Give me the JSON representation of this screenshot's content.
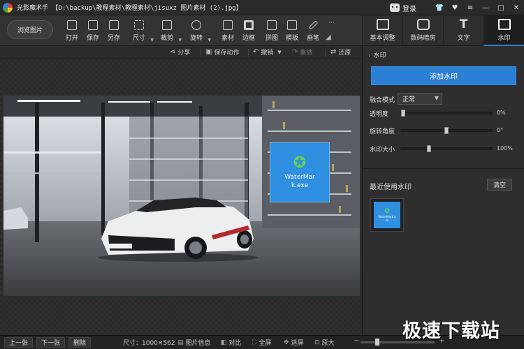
{
  "window": {
    "title": "光影魔术手 【D:\\backup\\教程素材\\教程素材\\jisuxz 图片素材 (2).jpg】",
    "login_label": "登录",
    "controls": [
      "shirt-icon",
      "heart-icon",
      "menu-icon",
      "minimize-icon",
      "maximize-icon",
      "close-icon"
    ]
  },
  "toolbar": {
    "browse_label": "浏览图片",
    "tools": [
      {
        "label": "打开",
        "icon": "open-icon"
      },
      {
        "label": "保存",
        "icon": "save-icon"
      },
      {
        "label": "另存",
        "icon": "save-as-icon"
      },
      {
        "label": "尺寸",
        "icon": "resize-icon"
      },
      {
        "label": "裁剪",
        "icon": "crop-icon"
      },
      {
        "label": "旋转",
        "icon": "rotate-icon"
      },
      {
        "label": "素材",
        "icon": "material-icon"
      },
      {
        "label": "边框",
        "icon": "border-icon"
      },
      {
        "label": "拼图",
        "icon": "collage-icon"
      },
      {
        "label": "模板",
        "icon": "template-icon"
      },
      {
        "label": "画笔",
        "icon": "brush-icon"
      }
    ],
    "more_label": "···"
  },
  "right_tabs": [
    {
      "label": "基本调整",
      "icon": "adjust-icon"
    },
    {
      "label": "数码暗房",
      "icon": "camera-icon"
    },
    {
      "label": "文字",
      "icon": "text-icon"
    },
    {
      "label": "水印",
      "icon": "watermark-icon",
      "active": true
    }
  ],
  "actionbar": {
    "share": "分享",
    "save_action": "保存动作",
    "undo": "撤销",
    "redo": "重做",
    "restore": "还原"
  },
  "canvas": {
    "watermark_text": "WaterMark.exe"
  },
  "panel": {
    "heading": "水印",
    "add_button": "添加水印",
    "blend_label": "融合模式",
    "blend_value": "正常",
    "opacity_label": "透明度",
    "opacity_value": "0%",
    "opacity_level": 0,
    "rotation_label": "旋转角度",
    "rotation_value": "0°",
    "rotation_level": 0.5,
    "size_label": "水印大小",
    "size_value": "100%",
    "size_level": 0.3,
    "recent_title": "最近使用水印",
    "clear_label": "清空",
    "thumb_text": "WaterMark.exe"
  },
  "statusbar": {
    "prev": "上一张",
    "next": "下一张",
    "delete": "删除",
    "size_info": "尺寸：1000×562",
    "image_info": "图片信息",
    "compare": "对比",
    "fullscreen": "全屏",
    "fit": "适屏",
    "original": "原大"
  },
  "site_watermark": "极速下载站",
  "colors": {
    "accent": "#2b7fd4",
    "watermark_bg": "#2f8fe0",
    "watermark_star": "#6bd14a"
  }
}
